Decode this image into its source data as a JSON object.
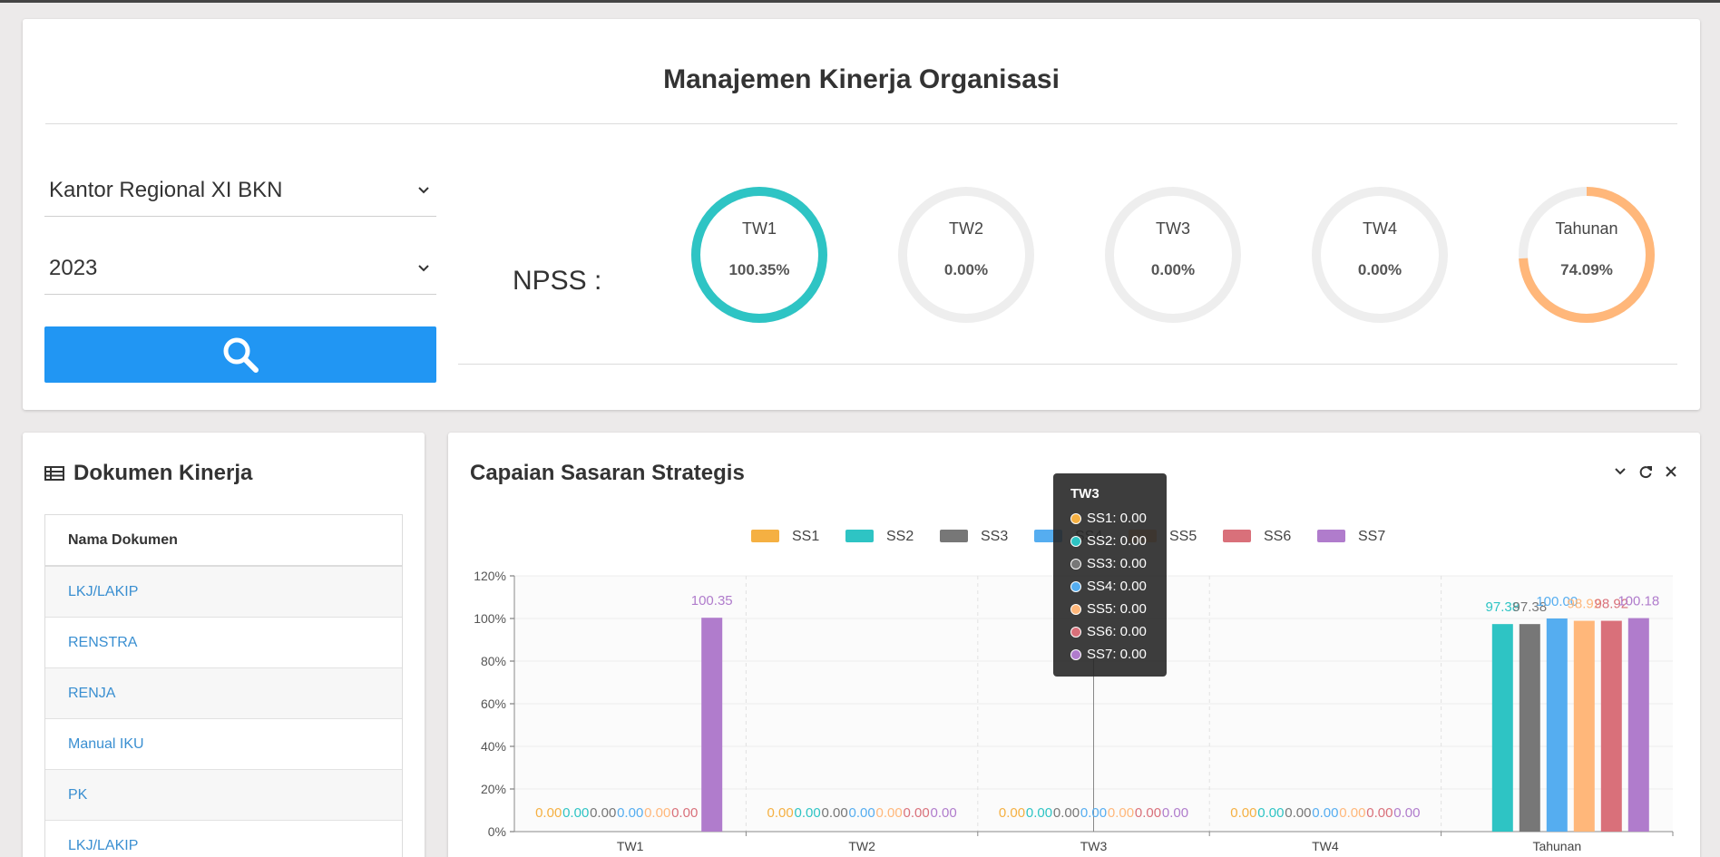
{
  "page": {
    "title": "Manajemen Kinerja Organisasi",
    "office_select": "Kantor Regional XI BKN",
    "year_select": "2023",
    "search_icon": "search-icon"
  },
  "npss": {
    "label": "NPSS :",
    "gauges": [
      {
        "label": "TW1",
        "value": "100.35%",
        "fill": 1.0,
        "color": "#2ec4c4"
      },
      {
        "label": "TW2",
        "value": "0.00%",
        "fill": 0.0,
        "color": "#2ec4c4"
      },
      {
        "label": "TW3",
        "value": "0.00%",
        "fill": 0.0,
        "color": "#2ec4c4"
      },
      {
        "label": "TW4",
        "value": "0.00%",
        "fill": 0.0,
        "color": "#2ec4c4"
      },
      {
        "label": "Tahunan",
        "value": "74.09%",
        "fill": 0.7409,
        "color": "#ffb77a"
      }
    ]
  },
  "docs": {
    "title": "Dokumen Kinerja",
    "icon": "list-table-icon",
    "header": "Nama Dokumen",
    "rows": [
      "LKJ/LAKIP",
      "RENSTRA",
      "RENJA",
      "Manual IKU",
      "PK",
      "LKJ/LAKIP"
    ]
  },
  "chart_panel": {
    "title": "Capaian Sasaran Strategis",
    "tools": [
      "chevron-down-icon",
      "refresh-icon",
      "close-icon"
    ]
  },
  "tooltip": {
    "title": "TW3",
    "rows": [
      "SS1: 0.00",
      "SS2: 0.00",
      "SS3: 0.00",
      "SS4: 0.00",
      "SS5: 0.00",
      "SS6: 0.00",
      "SS7: 0.00"
    ]
  },
  "chart_data": {
    "type": "bar",
    "categories": [
      "TW1",
      "TW2",
      "TW3",
      "TW4",
      "Tahunan"
    ],
    "ylim": [
      0,
      120
    ],
    "yticks": [
      "0%",
      "20%",
      "40%",
      "60%",
      "80%",
      "100%",
      "120%"
    ],
    "legend_position": "top",
    "grid": true,
    "series": [
      {
        "name": "SS1",
        "color": "#f5b042",
        "values": [
          0.0,
          0.0,
          0.0,
          0.0,
          null
        ],
        "labels": [
          "0.00",
          "0.00",
          "0.00",
          "0.00",
          ""
        ]
      },
      {
        "name": "SS2",
        "color": "#2ec4c4",
        "values": [
          0.0,
          0.0,
          0.0,
          0.0,
          97.38
        ],
        "labels": [
          "0.00",
          "0.00",
          "0.00",
          "0.00",
          "97.38"
        ]
      },
      {
        "name": "SS3",
        "color": "#777777",
        "values": [
          0.0,
          0.0,
          0.0,
          0.0,
          97.38
        ],
        "labels": [
          "0.00",
          "0.00",
          "0.00",
          "0.00",
          "97.38"
        ]
      },
      {
        "name": "SS4",
        "color": "#55adf0",
        "values": [
          0.0,
          0.0,
          0.0,
          0.0,
          100.0
        ],
        "labels": [
          "0.00",
          "0.00",
          "0.00",
          "0.00",
          "100.00"
        ]
      },
      {
        "name": "SS5",
        "color": "#ffb77a",
        "values": [
          0.0,
          0.0,
          0.0,
          0.0,
          98.92
        ],
        "labels": [
          "0.00",
          "0.00",
          "0.00",
          "0.00",
          "98.92"
        ]
      },
      {
        "name": "SS6",
        "color": "#d9707a",
        "values": [
          0.0,
          0.0,
          0.0,
          0.0,
          98.92
        ],
        "labels": [
          "0.00",
          "0.00",
          "0.00",
          "0.00",
          "98.92"
        ]
      },
      {
        "name": "SS7",
        "color": "#b07ccc",
        "values": [
          100.35,
          0.0,
          0.0,
          0.0,
          100.18
        ],
        "labels": [
          "100.35",
          "0.00",
          "0.00",
          "0.00",
          "100.18"
        ]
      }
    ]
  }
}
